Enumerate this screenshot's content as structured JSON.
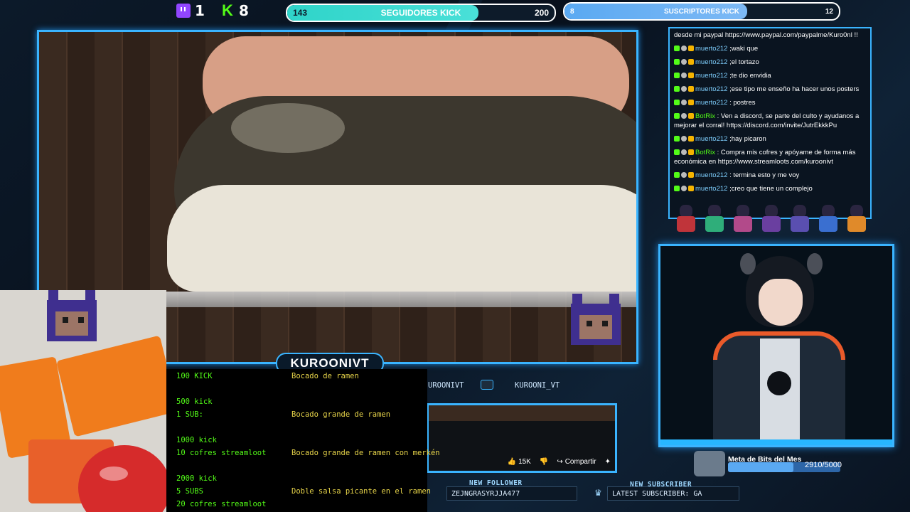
{
  "top": {
    "twitch_count": "1",
    "kick_count": "8",
    "followers_goal": {
      "current": "143",
      "label": "SEGUIDORES KICK",
      "target": "200",
      "progress": 0.715
    },
    "subs_goal": {
      "current": "8",
      "label": "SUSCRIPTORES KICK",
      "target": "12",
      "progress": 0.667
    }
  },
  "chat": {
    "messages": [
      {
        "user": "",
        "text": "desde mi paypal https://www.paypal.com/paypalme/Kuro0nl !!"
      },
      {
        "user": "muerto212",
        "text": ";waki que"
      },
      {
        "user": "muerto212",
        "text": ";el tortazo"
      },
      {
        "user": "muerto212",
        "text": ";te dio envidia"
      },
      {
        "user": "muerto212",
        "text": ";ese tipo me enseño ha hacer unos posters"
      },
      {
        "user": "muerto212",
        "text": ": postres"
      },
      {
        "user": "BotRix",
        "text": ": Ven a discord, se parte del culto y ayudanos a mejorar el corral! https://discord.com/invite/JutrEkkkPu"
      },
      {
        "user": "muerto212",
        "text": ";hay picaron"
      },
      {
        "user": "BotRix",
        "text": ": Compra mis cofres y apóyame de forma más económica en https://www.streamloots.com/kuroonivt"
      },
      {
        "user": "muerto212",
        "text": ": termina esto y me voy"
      },
      {
        "user": "muerto212",
        "text": ";creo que tiene un complejo"
      }
    ]
  },
  "name_plate": "KUROONIVT",
  "socials": {
    "kick_handle": "UROONIVT",
    "youtube_handle": "KUROONI_VT"
  },
  "yt_preview": {
    "likes": "15K",
    "share": "Compartir"
  },
  "events": {
    "follower_label": "NEW FOLLOWER",
    "follower_value": "ZEJNGRASYRJJA477",
    "subscriber_label": "NEW SUBSCRIBER",
    "subscriber_value": "LATEST SUBSCRIBER: GA"
  },
  "bits_goal": {
    "title": "Meta de Bits del Mes",
    "value": "2910/5000",
    "progress": 0.582
  },
  "rewards": {
    "tiers": [
      {
        "cost": [
          "100 KICK"
        ],
        "reward": "Bocado de ramen"
      },
      {
        "cost": [
          "500 kick",
          "1 SUB:"
        ],
        "reward": "Bocado grande de ramen"
      },
      {
        "cost": [
          "1000 kick",
          "10 cofres streamloot"
        ],
        "reward": "Bocado grande de ramen con merkén"
      },
      {
        "cost": [
          "2000 kick",
          "5 SUBS",
          "20 cofres streamloot"
        ],
        "reward": "Doble salsa picante en el ramen"
      }
    ]
  },
  "colors": {
    "accent": "#3ab4ff",
    "kick_green": "#53fc18",
    "twitch_purple": "#9146ff",
    "reward_yellow": "#e7d44a"
  }
}
